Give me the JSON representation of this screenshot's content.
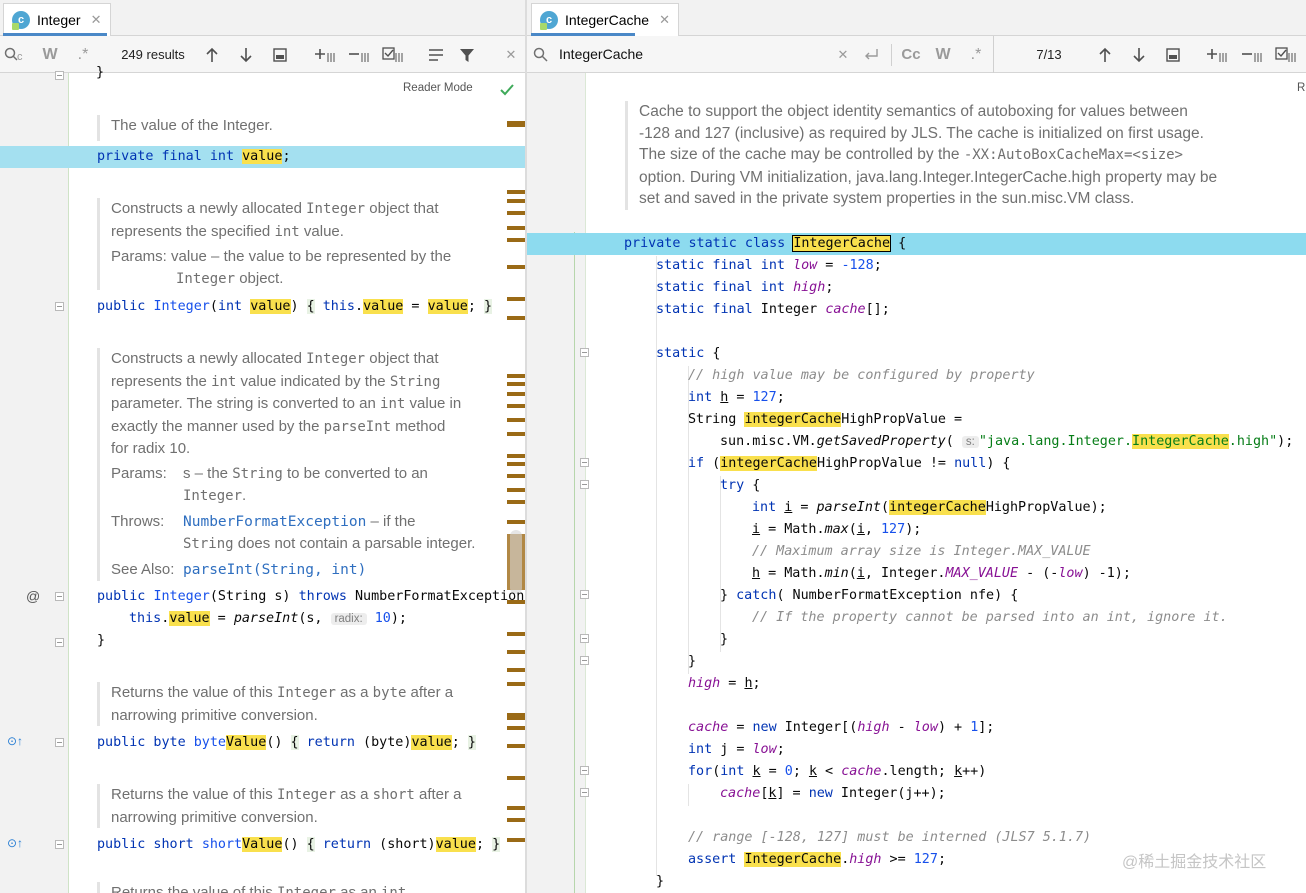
{
  "left": {
    "tab": {
      "title": "Integer",
      "icon": "class-icon",
      "close": "✕"
    },
    "find": {
      "results": "249 results"
    },
    "reader_mode": "Reader Mode",
    "doc1": "The value of the Integer.",
    "doc2": {
      "l1a": "Constructs a newly allocated",
      "l1m": "Integer",
      "l1b": "object that",
      "l2a": "represents the specified",
      "l2m": "int",
      "l2b": "value.",
      "p_label": "Params:",
      "p1": "value – the value to be represented by the",
      "p2m": "Integer",
      "p2b": "object."
    },
    "doc3": {
      "l1a": "Constructs a newly allocated",
      "l1m": "Integer",
      "l1b": "object that",
      "l2a": "represents the",
      "l2m": "int",
      "l2b": "value indicated by the",
      "l2m2": "String",
      "l3a": "parameter. The string is converted to an",
      "l3m": "int",
      "l3b": "value in",
      "l4a": "exactly the manner used by the",
      "l4m": "parseInt",
      "l4b": "method",
      "l5": "for radix 10.",
      "p_label": "Params:",
      "p1a": "s – the",
      "p1m": "String",
      "p1b": "to be converted to an",
      "p2m": "Integer",
      "p2b": ".",
      "t_label": "Throws:",
      "t1l": "NumberFormatException",
      "t1b": "– if the",
      "t2m": "String",
      "t2b": "does not contain a parsable integer.",
      "s_label": "See Also:",
      "s1": "parseInt(String, int)"
    },
    "doc4": {
      "l1a": "Returns the value of this",
      "l1m": "Integer",
      "l1b": "as a",
      "l1m2": "byte",
      "l1c": "after a",
      "l2": "narrowing primitive conversion."
    },
    "doc5": {
      "l1a": "Returns the value of this",
      "l1m": "Integer",
      "l1b": "as a",
      "l1m2": "short",
      "l1c": "after a",
      "l2": "narrowing primitive conversion."
    },
    "doc6": {
      "l1a": "Returns the value of this",
      "l1m": "Integer",
      "l1b": "as an",
      "l1m2": "int"
    },
    "code": {
      "brace": "}",
      "c1_kw": "private final int",
      "c1_hl": "value",
      "c1_end": ";",
      "c2_kw": "public",
      "c2_t": "Integer",
      "c2_a": "(",
      "c2_int": "int",
      "c2_v": "value",
      "c2_b": ")",
      "c2_f1": "{",
      "c2_this": "this",
      "c2_dot": ".",
      "c2_v2": "value",
      "c2_eq": " = ",
      "c2_v3": "value",
      "c2_sc": ";",
      "c2_f2": "}",
      "c3_kw": "public",
      "c3_t": "Integer",
      "c3_a": "(String s)",
      "c3_throws": "throws",
      "c3_e": "NumberFormatException",
      "c4_this": "this",
      "c4_dot": ".",
      "c4_v": "value",
      "c4_eq": " = ",
      "c4_m": "parseInt",
      "c4_a": "(s, ",
      "c4_hint": "radix:",
      "c4_n": "10",
      "c4_e": ");",
      "c5": "}",
      "c6_kw": "public byte",
      "c6_n": "byte",
      "c6_hl": "Value",
      "c6_a": "()",
      "c6_f1": "{",
      "c6_ret": "return",
      "c6_c": " (byte)",
      "c6_v": "value",
      "c6_sc": ";",
      "c6_f2": "}",
      "c7_kw": "public short",
      "c7_n": "short",
      "c7_hl": "Value",
      "c7_a": "()",
      "c7_f1": "{",
      "c7_ret": "return",
      "c7_c": " (short)",
      "c7_v": "value",
      "c7_sc": ";",
      "c7_f2": "}"
    },
    "gutter_icons": {
      "at": "@",
      "override": "⊙↑"
    }
  },
  "right": {
    "tab": {
      "title": "IntegerCache",
      "icon": "class-icon",
      "close": "✕"
    },
    "find": {
      "query": "IntegerCache",
      "results": "7/13",
      "case": "Cc",
      "words": "W",
      "regex": ".*"
    },
    "reader_mode": "R",
    "doc": [
      "Cache to support the object identity semantics of autoboxing for values between",
      "-128 and 127 (inclusive) as required by JLS. The cache is initialized on first usage.",
      "The size of the cache may be controlled by the",
      "-XX:AutoBoxCacheMax=<size>",
      "option. During VM initialization, java.lang.Integer.IntegerCache.high property may be",
      "set and saved in the private system properties in the sun.misc.VM class."
    ],
    "code": {
      "l1_kw": "private static class",
      "l1_hl": "IntegerCache",
      "l1_e": " {",
      "l2_kw": "static final int",
      "l2_f": "low",
      "l2_e": " = ",
      "l2_n": "-128",
      "l2_s": ";",
      "l3_kw": "static final int",
      "l3_f": "high",
      "l3_s": ";",
      "l4_kw": "static final",
      "l4_t": " Integer ",
      "l4_f": "cache",
      "l4_e": "[];",
      "l5_kw": "static",
      "l5_e": " {",
      "l6": "// high value may be configured by property",
      "l7_kw": "int",
      "l7_v": "h",
      "l7_e": " = ",
      "l7_n": "127",
      "l7_s": ";",
      "l8_t": "String ",
      "l8_hl": "integerCache",
      "l8_e": "HighPropValue =",
      "l9_a": "sun.misc.VM.",
      "l9_m": "getSavedProperty",
      "l9_b": "( ",
      "l9_hint": "s:",
      "l9_s1": "\"java.lang.Integer.",
      "l9_hl": "IntegerCache",
      "l9_s2": ".high\"",
      "l9_e": ");",
      "l10_kw": "if",
      "l10_a": " (",
      "l10_hl": "integerCache",
      "l10_b": "HighPropValue != ",
      "l10_null": "null",
      "l10_e": ") {",
      "l11_kw": "try",
      "l11_e": " {",
      "l12_kw": "int",
      "l12_v": "i",
      "l12_a": " = ",
      "l12_m": "parseInt",
      "l12_b": "(",
      "l12_hl": "integerCache",
      "l12_e": "HighPropValue);",
      "l13_v": "i",
      "l13_a": " = Math.",
      "l13_m": "max",
      "l13_b": "(",
      "l13_v2": "i",
      "l13_c": ", ",
      "l13_n": "127",
      "l13_e": ");",
      "l14": "// Maximum array size is Integer.MAX_VALUE",
      "l15_v": "h",
      "l15_a": " = Math.",
      "l15_m": "min",
      "l15_b": "(",
      "l15_v2": "i",
      "l15_c": ", Integer.",
      "l15_f": "MAX_VALUE",
      "l15_d": " - (-",
      "l15_f2": "low",
      "l15_e": ") -1);",
      "l16_a": "} ",
      "l16_kw": "catch",
      "l16_e": "( NumberFormatException nfe) {",
      "l17": "// If the property cannot be parsed into an int, ignore it.",
      "l18": "}",
      "l19": "}",
      "l20_f": "high",
      "l20_a": " = ",
      "l20_v": "h",
      "l20_e": ";",
      "l21_f": "cache",
      "l21_a": " = ",
      "l21_kw": "new",
      "l21_b": " Integer[(",
      "l21_f2": "high",
      "l21_c": " - ",
      "l21_f3": "low",
      "l21_d": ") + ",
      "l21_n": "1",
      "l21_e": "];",
      "l22_kw": "int",
      "l22_a": " j = ",
      "l22_f": "low",
      "l22_e": ";",
      "l23_kw": "for",
      "l23_a": "(",
      "l23_kw2": "int",
      "l23_b": " ",
      "l23_v": "k",
      "l23_c": " = ",
      "l23_n": "0",
      "l23_d": "; ",
      "l23_v2": "k",
      "l23_e": " < ",
      "l23_f": "cache",
      "l23_g": ".length; ",
      "l23_v3": "k",
      "l23_h": "++)",
      "l24_f": "cache",
      "l24_a": "[",
      "l24_v": "k",
      "l24_b": "] = ",
      "l24_kw": "new",
      "l24_e": " Integer(j++);",
      "l25": "// range [-128, 127] must be interned (JLS7 5.1.7)",
      "l26_kw": "assert",
      "l26_a": " ",
      "l26_hl": "IntegerCache",
      "l26_b": ".",
      "l26_f": "high",
      "l26_c": " >= ",
      "l26_n": "127",
      "l26_e": ";",
      "l27": "}"
    }
  },
  "watermark": "@稀土掘金技术社区"
}
